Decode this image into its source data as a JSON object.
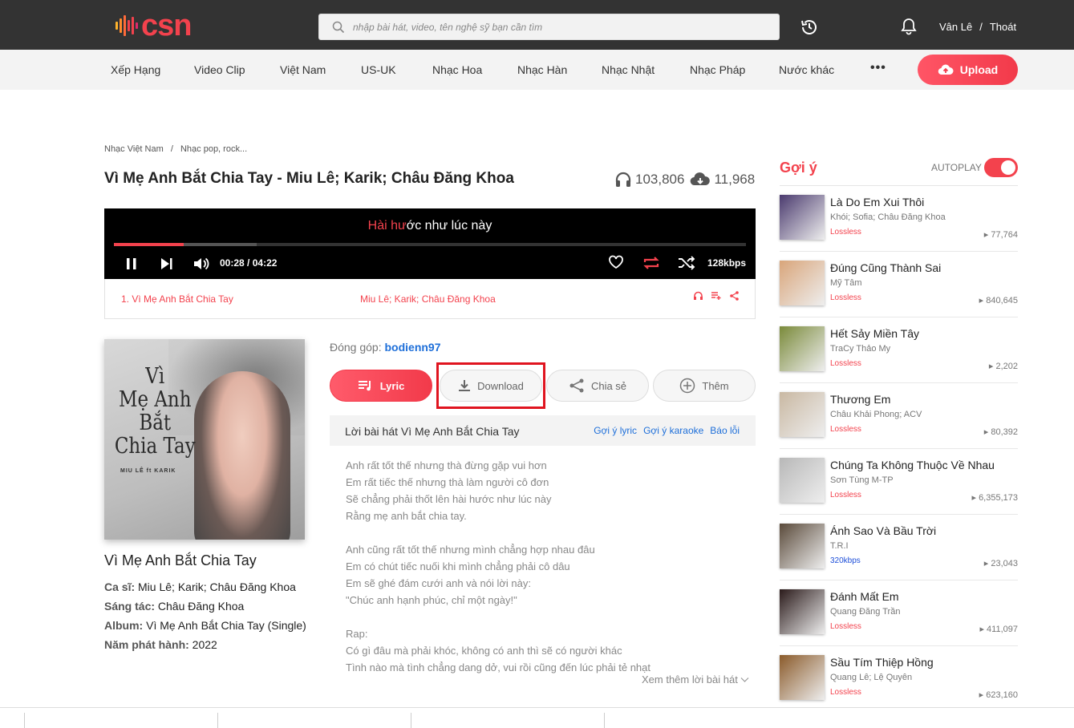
{
  "header": {
    "logo_text": "csn",
    "search_placeholder": "nhập bài hát, video, tên nghệ sỹ bạn cần tìm",
    "user_name": "Vân Lê",
    "separator": "/",
    "logout": "Thoát"
  },
  "nav": {
    "items": [
      "Xếp Hạng",
      "Video Clip",
      "Việt Nam",
      "US-UK",
      "Nhạc Hoa",
      "Nhạc Hàn",
      "Nhạc Nhật",
      "Nhạc Pháp",
      "Nước khác"
    ],
    "more": "•••",
    "upload": "Upload"
  },
  "breadcrumb": {
    "first": "Nhạc Việt Nam",
    "sep": "/",
    "second": "Nhạc pop, rock..."
  },
  "song": {
    "title": "Vì Mẹ Anh Bắt Chia Tay - Miu Lê; Karik; Châu Đăng Khoa",
    "listens": "103,806",
    "downloads": "11,968"
  },
  "player": {
    "lyric_highlight": "Hài hư",
    "lyric_rest": "ớc như lúc này",
    "current_time": "00:28",
    "time_sep": "/",
    "duration": "04:22",
    "quality": "128kbps",
    "progress": 0.11,
    "buffered": 0.226
  },
  "playlist": {
    "title": "1. Vì Mẹ Anh Bắt Chia Tay",
    "artist": "Miu Lê; Karik; Châu Đăng Khoa"
  },
  "album": {
    "cover_title": "Vì\nMẹ Anh\nBắt\nChia Tay",
    "cover_artist": "MIU LÊ  ft  KARIK",
    "name": "Vì Mẹ Anh Bắt Chia Tay",
    "singer_label": "Ca sĩ:",
    "singer": "Miu Lê; Karik; Châu Đăng Khoa",
    "composer_label": "Sáng tác:",
    "composer": "Châu Đăng Khoa",
    "album_label": "Album:",
    "album": "Vì Mẹ Anh Bắt Chia Tay (Single)",
    "year_label": "Năm phát hành:",
    "year": "2022"
  },
  "contribution": {
    "label": "Đóng góp:",
    "user": "bodienn97"
  },
  "tabs": {
    "lyric": "Lyric",
    "download": "Download",
    "share": "Chia sẻ",
    "more": "Thêm"
  },
  "lyrics": {
    "title": "Lời bài hát Vì Mẹ Anh Bắt Chia Tay",
    "link_lyric": "Gợi ý lyric",
    "link_karaoke": "Gợi ý karaoke",
    "link_report": "Báo lỗi",
    "text": "Anh rất tốt thế nhưng thà đừng gặp vui hơn\nEm rất tiếc thế nhưng thà làm người cô đơn\nSẽ chẳng phải thốt lên hài hước như lúc này\nRằng mẹ anh bắt chia tay.\n\nAnh cũng rất tốt thế nhưng mình chẳng hợp nhau đâu\nEm có chút tiếc nuối khi mình chẳng phải cô dâu\nEm sẽ ghé đám cưới anh và nói lời này:\n\"Chúc anh hạnh phúc, chỉ một ngày!\"\n\nRap:\nCó gì đâu mà phải khóc, không có anh thì sẽ có người khác\nTình nào mà tình chẳng dang dở, vui rồi cũng đến lúc phải tẻ nhạt",
    "more": "Xem thêm lời bài hát"
  },
  "sidebar": {
    "title": "Gợi ý",
    "autoplay": "AUTOPLAY",
    "autoplay_on": true,
    "items": [
      {
        "title": "Là Do Em Xui Thôi",
        "artist": "Khói; Sofia; Châu Đăng Khoa",
        "quality": "Lossless",
        "count": "77,764",
        "color": "#4a3a6e"
      },
      {
        "title": "Đúng Cũng Thành Sai",
        "artist": "Mỹ Tâm",
        "quality": "Lossless",
        "count": "840,645",
        "color": "#d9a57a"
      },
      {
        "title": "Hết Sảy Miền Tây",
        "artist": "TraCy Thảo My",
        "quality": "Lossless",
        "count": "2,202",
        "color": "#7a8a3a"
      },
      {
        "title": "Thương Em",
        "artist": "Châu Khải Phong; ACV",
        "quality": "Lossless",
        "count": "80,392",
        "color": "#c9b8a2"
      },
      {
        "title": "Chúng Ta Không Thuộc Về Nhau",
        "artist": "Sơn Tùng M-TP",
        "quality": "Lossless",
        "count": "6,355,173",
        "color": "#b8b8b8"
      },
      {
        "title": "Ánh Sao Và Bầu Trời",
        "artist": "T.R.I",
        "quality": "320kbps",
        "count": "23,043",
        "color": "#5a4a3a"
      },
      {
        "title": "Đánh Mất Em",
        "artist": "Quang Đăng Trần",
        "quality": "Lossless",
        "count": "411,097",
        "color": "#2a1a1a"
      },
      {
        "title": "Sầu Tím Thiệp Hồng",
        "artist": "Quang Lê; Lệ Quyên",
        "quality": "Lossless",
        "count": "623,160",
        "color": "#8a5a2a"
      }
    ]
  }
}
